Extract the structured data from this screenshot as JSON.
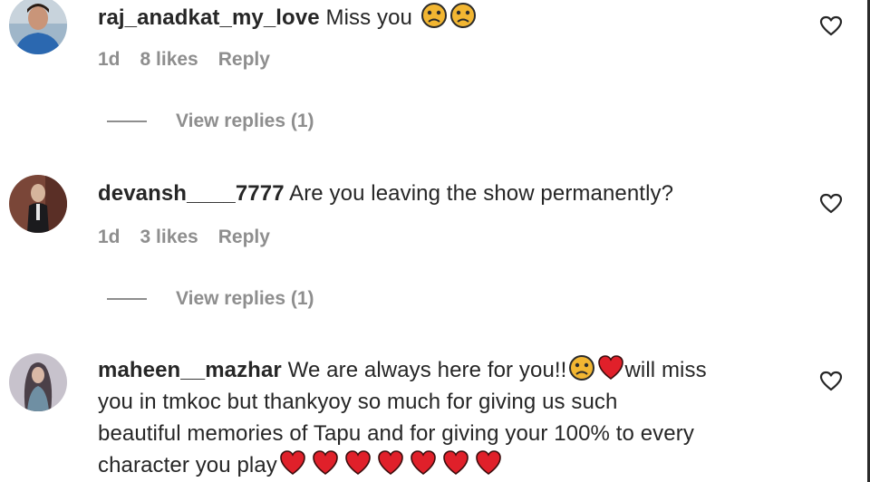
{
  "comments": [
    {
      "username": "raj_anadkat_my_love",
      "text": "Miss you",
      "emojis": [
        "sad-face",
        "sad-face"
      ],
      "time": "1d",
      "likes": "8 likes",
      "reply": "Reply",
      "view_replies": "View replies (1)"
    },
    {
      "username": "devansh____7777",
      "text": "Are you leaving the show permanently?",
      "time": "1d",
      "likes": "3 likes",
      "reply": "Reply",
      "view_replies": "View replies (1)"
    },
    {
      "username": "maheen__mazhar",
      "text_part1": "We are always here for you!!",
      "text_part2": "will miss",
      "line2": "you in tmkoc but thankyoy so much for giving us such",
      "line3": "beautiful memories of Tapu and for giving your 100% to every",
      "line4": "character you play"
    }
  ],
  "colors": {
    "primary_text": "#262626",
    "secondary_text": "#8e8e8e",
    "heart_red": "#e0202a",
    "emoji_yellow": "#f2b632"
  }
}
